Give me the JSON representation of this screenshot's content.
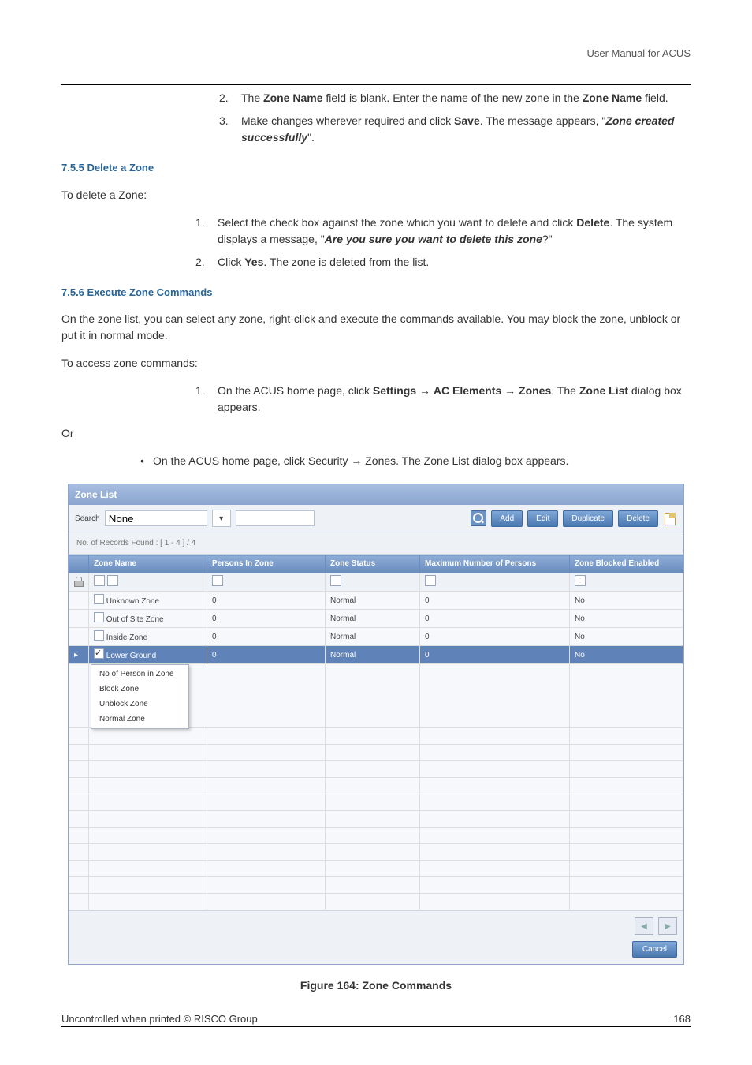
{
  "header": {
    "doc_title": "User Manual for ACUS"
  },
  "step2": {
    "num": "2.",
    "pre": "The ",
    "b1": "Zone Name",
    "mid": " field is blank. Enter the name of the new zone in the ",
    "b2": "Zone Name",
    "post": " field."
  },
  "step3": {
    "num": "3.",
    "pre": "Make changes wherever required and click ",
    "b1": "Save",
    "mid": ". The message appears, \"",
    "bi": "Zone created successfully",
    "post": "\"."
  },
  "sec755": {
    "heading": "7.5.5  Delete a Zone",
    "intro": "To delete a Zone:",
    "s1": {
      "num": "1.",
      "pre": "Select the check box against the zone which you want to delete and click ",
      "b1": "Delete",
      "mid": ". The system displays a message, \"",
      "bi": "Are you sure you want to delete this zone",
      "post": "?\""
    },
    "s2": {
      "num": "2.",
      "pre": "Click ",
      "b1": "Yes",
      "post": ". The zone is deleted from the list."
    }
  },
  "sec756": {
    "heading": "7.5.6  Execute Zone Commands",
    "p1": "On the zone list, you can select any zone, right-click and execute the commands available. You may block the zone, unblock or put it in normal mode.",
    "p2": "To access zone commands:",
    "s1": {
      "num": "1.",
      "pre": "On the ACUS home page, click ",
      "b1": "Settings",
      "arr1": " → ",
      "b2": "AC Elements",
      "arr2": " → ",
      "b3": "Zones",
      "mid": ". The ",
      "b4": "Zone List",
      "post": " dialog box appears."
    },
    "or": "Or",
    "bullet": "On the ACUS home page, click Security → Zones. The Zone List dialog box appears."
  },
  "shot": {
    "title": "Zone List",
    "search_label": "Search",
    "search_value": "None",
    "btn_add": "Add",
    "btn_edit": "Edit",
    "btn_dup": "Duplicate",
    "btn_del": "Delete",
    "records": "No. of Records Found    : [ 1 - 4 ] / 4",
    "cols": {
      "c1": "Zone Name",
      "c2": "Persons In Zone",
      "c3": "Zone Status",
      "c4": "Maximum Number of Persons",
      "c5": "Zone Blocked Enabled"
    },
    "rows": [
      {
        "name": "Unknown Zone",
        "persons": "0",
        "status": "Normal",
        "max": "0",
        "blocked": "No"
      },
      {
        "name": "Out of Site Zone",
        "persons": "0",
        "status": "Normal",
        "max": "0",
        "blocked": "No"
      },
      {
        "name": "Inside Zone",
        "persons": "0",
        "status": "Normal",
        "max": "0",
        "blocked": "No"
      },
      {
        "name": "Lower Ground",
        "persons": "0",
        "status": "Normal",
        "max": "0",
        "blocked": "No"
      }
    ],
    "menu": {
      "m1": "No of Person in Zone",
      "m2": "Block Zone",
      "m3": "Unblock Zone",
      "m4": "Normal Zone"
    },
    "cancel": "Cancel"
  },
  "figcap": "Figure 164: Zone Commands",
  "footer": {
    "left": "Uncontrolled when printed © RISCO Group",
    "right": "168"
  }
}
